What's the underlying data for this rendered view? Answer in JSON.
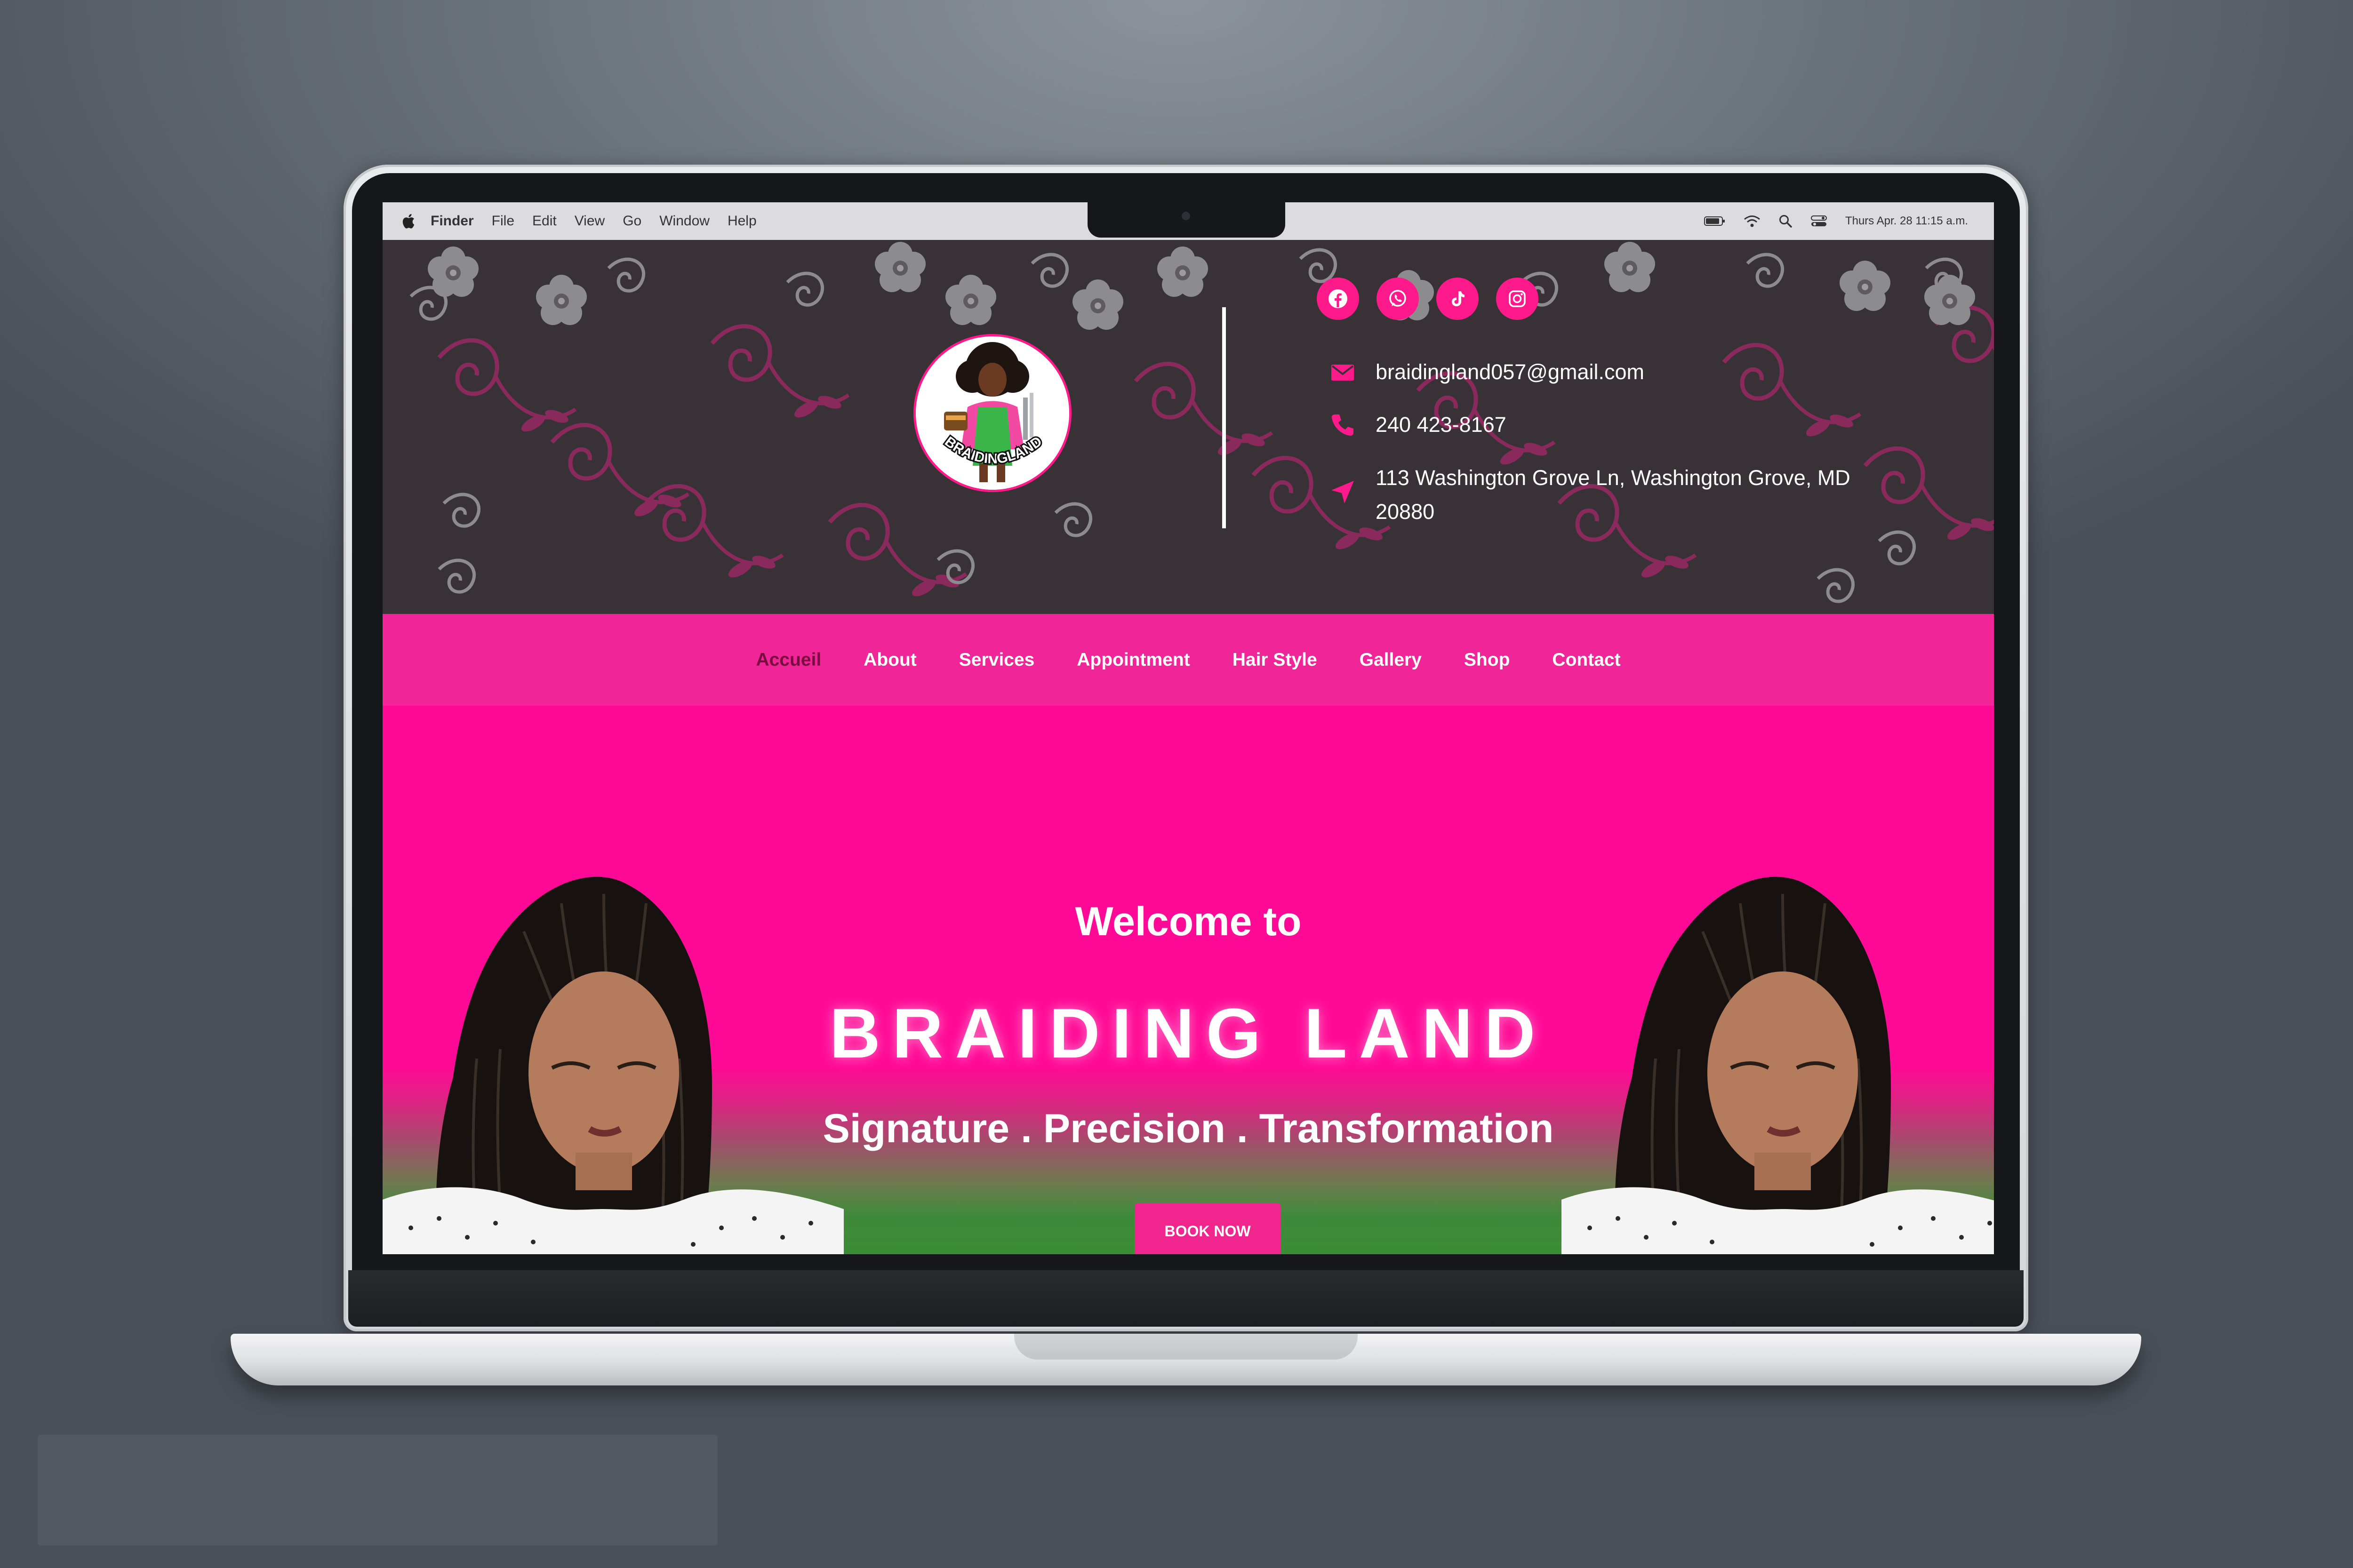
{
  "menubar": {
    "items": [
      "Finder",
      "File",
      "Edit",
      "View",
      "Go",
      "Window",
      "Help"
    ],
    "clock": "Thurs Apr. 28 11:15 a.m."
  },
  "header": {
    "logo_text": "BRAIDINGLAND",
    "socials": [
      "facebook-icon",
      "whatsapp-icon",
      "tiktok-icon",
      "instagram-icon"
    ],
    "email": "braidingland057@gmail.com",
    "phone": "240 423-8167",
    "address": "113 Washington Grove Ln, Washington Grove, MD 20880"
  },
  "nav": {
    "items": [
      "Accueil",
      "About",
      "Services",
      "Appointment",
      "Hair Style",
      "Gallery",
      "Shop",
      "Contact"
    ],
    "active": "Accueil"
  },
  "hero": {
    "welcome": "Welcome to",
    "title": "BRAIDING LAND",
    "tagline": "Signature . Precision . Transformation",
    "cta": "BOOK NOW"
  },
  "colors": {
    "brand_pink": "#ff0a96",
    "nav_pink": "#f02597",
    "nav_active": "#7a0d3f",
    "header_dark": "#383236",
    "hero_green": "#3c8c35"
  }
}
